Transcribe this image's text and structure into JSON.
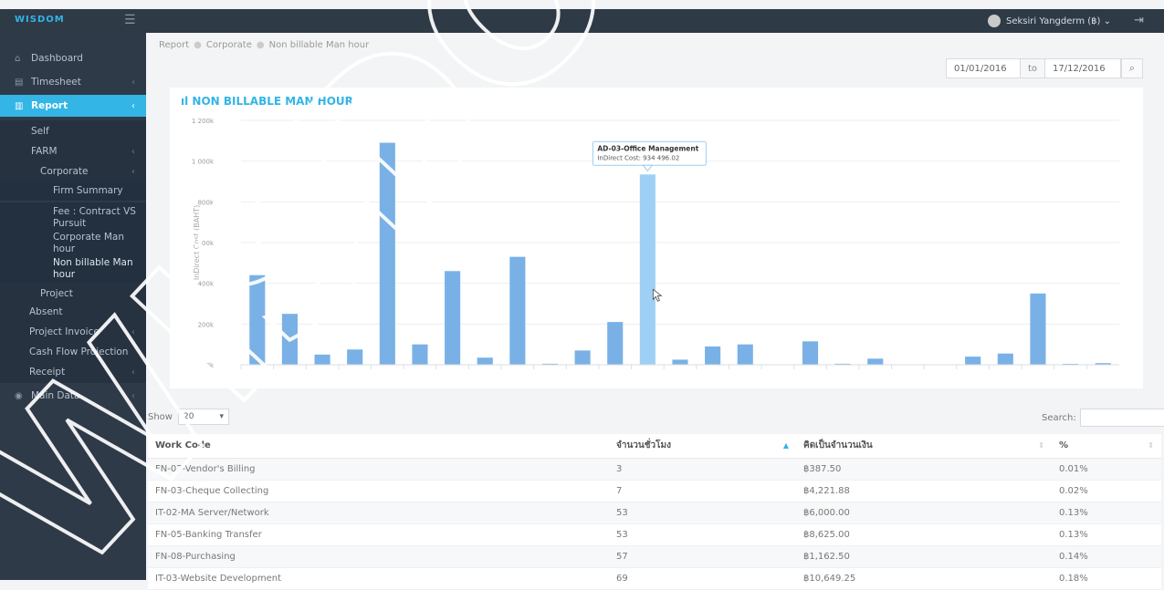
{
  "app": {
    "logo": "WISDOM",
    "user_name": "Seksiri Yangderm (฿) ⌄"
  },
  "sidebar": {
    "dashboard": "Dashboard",
    "timesheet": "Timesheet",
    "report": "Report",
    "self": "Self",
    "farm": "FARM",
    "corporate": "Corporate",
    "firm_summary": "Firm Summary",
    "fee_contract": "Fee : Contract VS Pursuit",
    "corporate_man_hour": "Corporate Man hour",
    "non_billable": "Non billable Man hour",
    "project": "Project",
    "absent": "Absent",
    "project_invoice": "Project Invoice",
    "cash_flow": "Cash Flow Projection",
    "receipt": "Receipt",
    "main_data": "Main Data"
  },
  "breadcrumb": {
    "items": [
      "Report",
      "Corporate",
      "Non billable Man hour"
    ]
  },
  "date_range": {
    "from": "01/01/2016",
    "to_label": "to",
    "to": "17/12/2016"
  },
  "chart_data": {
    "type": "bar",
    "title": "NON BILLABLE MAN HOUR",
    "ylabel": "InDirect Cost (BAHT)",
    "yticks": [
      "0k",
      "200k",
      "400k",
      "600k",
      "800k",
      "1 000k",
      "1 200k"
    ],
    "ylim": [
      0,
      1200000
    ],
    "values": [
      440000,
      250000,
      50000,
      75000,
      1090000,
      100000,
      460000,
      35000,
      530000,
      5000,
      70000,
      210000,
      934496.02,
      25000,
      90000,
      100000,
      0,
      115000,
      5000,
      30000,
      0,
      0,
      40000,
      55000,
      350000,
      2000,
      8000
    ],
    "highlight_index": 12,
    "tooltip": {
      "title": "AD-03-Office Management",
      "text": "InDirect Cost: 934 496.02"
    },
    "bar_color": "#79b1e6",
    "highlight_color": "#9ed0f6"
  },
  "table": {
    "show_label": "Show",
    "page_size": "20",
    "search_label": "Search:",
    "headers": [
      "Work Code",
      "จำนวนชั่วโมง",
      "คิดเป็นจำนวนเงิน",
      "%"
    ],
    "rows": [
      [
        "FN-07-Vendor's Billing",
        "3",
        "฿387.50",
        "0.01%"
      ],
      [
        "FN-03-Cheque Collecting",
        "7",
        "฿4,221.88",
        "0.02%"
      ],
      [
        "IT-02-MA Server/Network",
        "53",
        "฿6,000.00",
        "0.13%"
      ],
      [
        "FN-05-Banking Transfer",
        "53",
        "฿8,625.00",
        "0.13%"
      ],
      [
        "FN-08-Purchasing",
        "57",
        "฿1,162.50",
        "0.14%"
      ],
      [
        "IT-03-Website Development",
        "69",
        "฿10,649.25",
        "0.18%"
      ]
    ]
  },
  "watermark": "WISDOM"
}
